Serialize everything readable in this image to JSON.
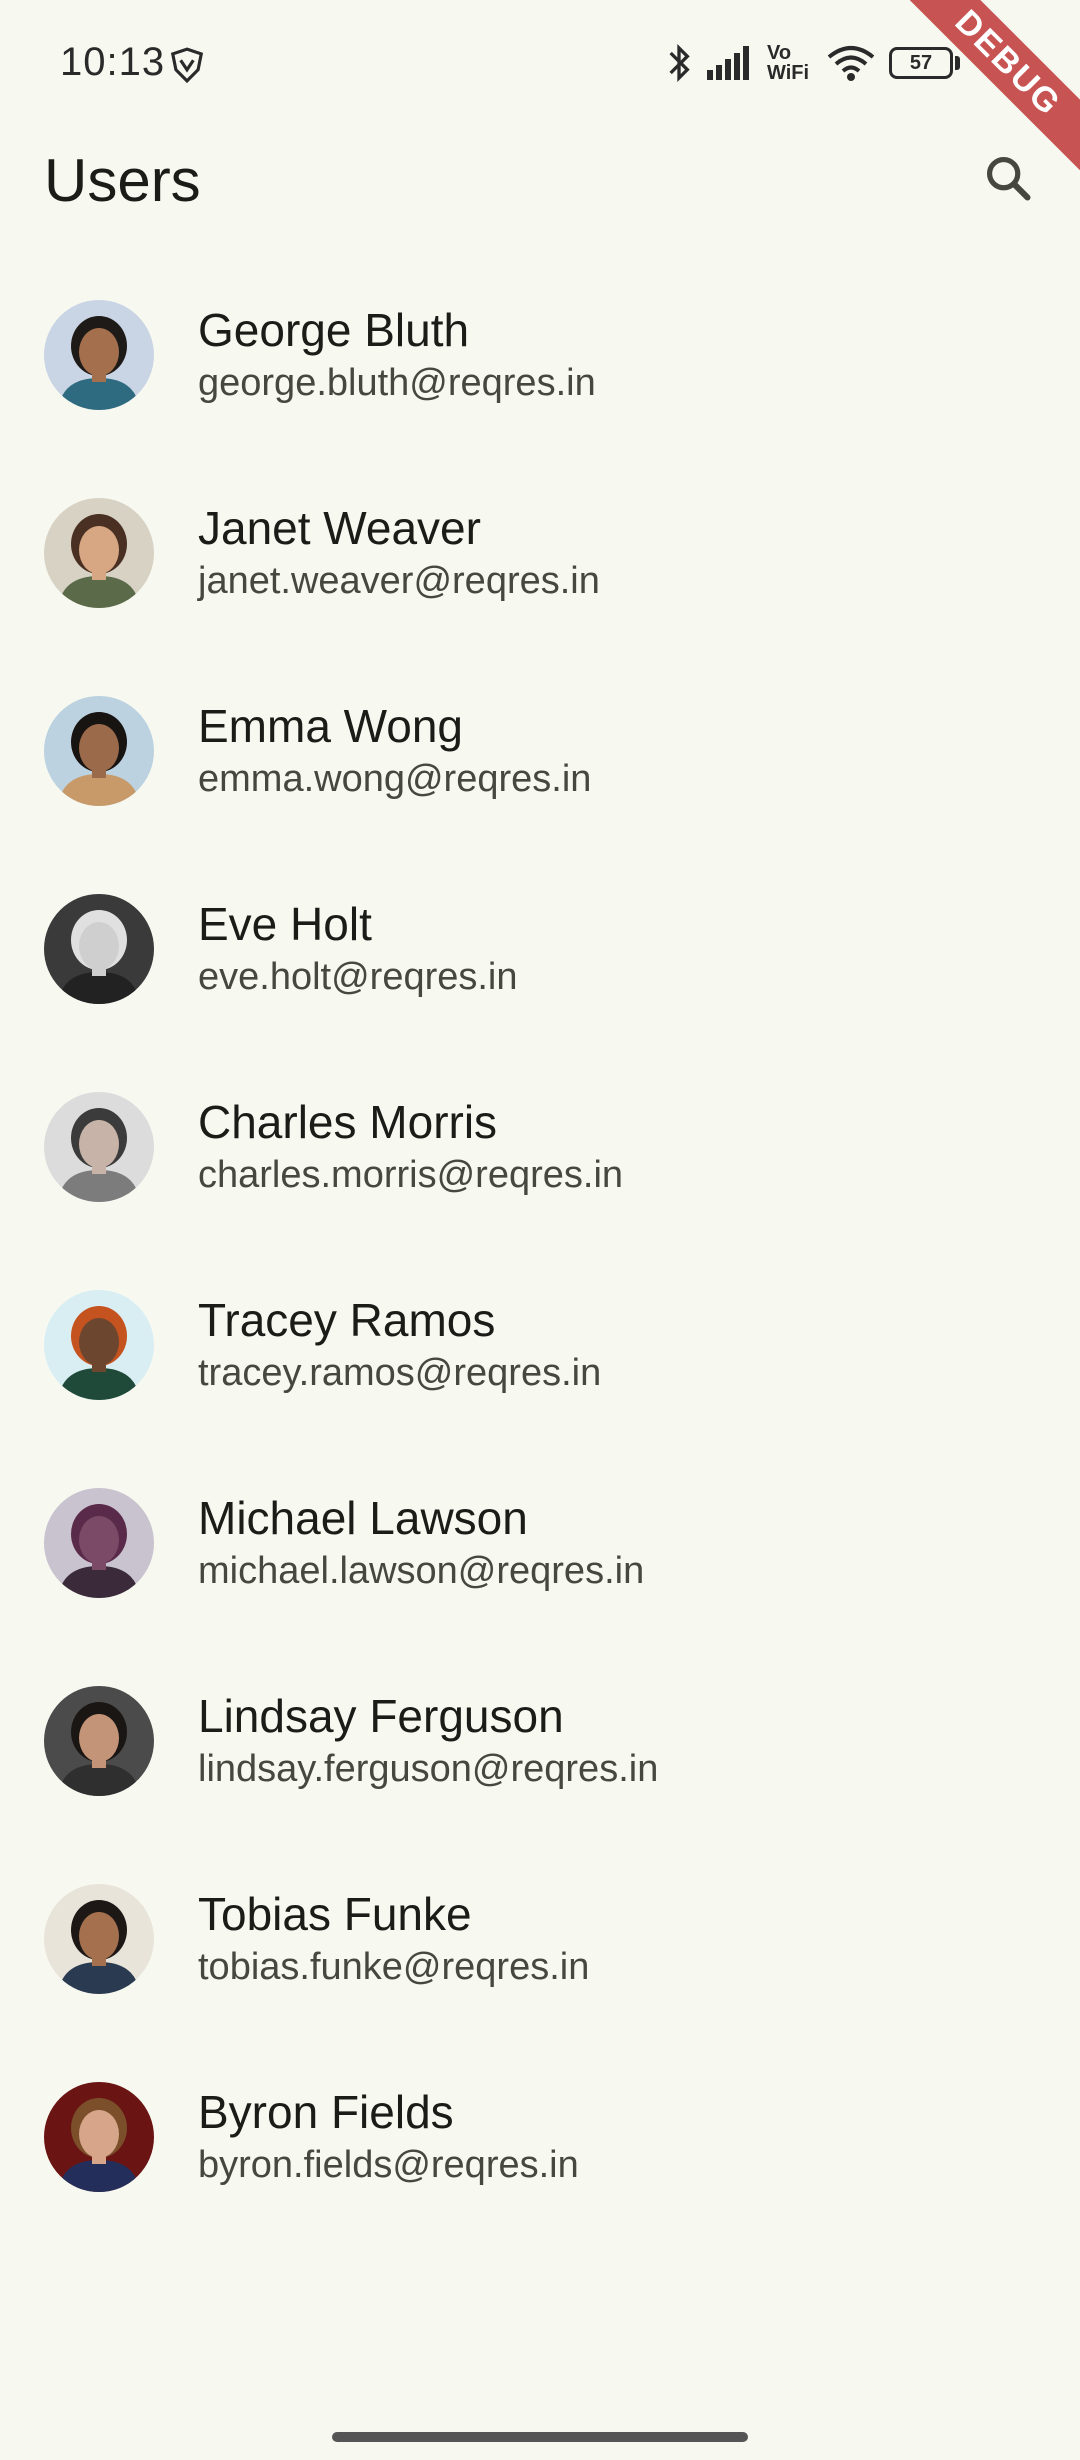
{
  "status_bar": {
    "time": "10:13",
    "volte_label": "Vo\nWiFi",
    "battery_level": "57"
  },
  "debug_banner": {
    "label": "DEBUG"
  },
  "app_bar": {
    "title": "Users",
    "search_icon": "search-icon"
  },
  "users": [
    {
      "name": "George Bluth",
      "email": "george.bluth@reqres.in",
      "avatar": {
        "bg": "#c9d4e4",
        "skin": "#a46f4d",
        "hair": "#1e1a17",
        "shirt": "#2f6b80"
      }
    },
    {
      "name": "Janet Weaver",
      "email": "janet.weaver@reqres.in",
      "avatar": {
        "bg": "#d8d2c4",
        "skin": "#d7a784",
        "hair": "#4a3022",
        "shirt": "#5b6b4a"
      }
    },
    {
      "name": "Emma Wong",
      "email": "emma.wong@reqres.in",
      "avatar": {
        "bg": "#bcd2e0",
        "skin": "#9b6a4b",
        "hair": "#171412",
        "shirt": "#c89a6a"
      }
    },
    {
      "name": "Eve Holt",
      "email": "eve.holt@reqres.in",
      "avatar": {
        "bg": "#3a3a3a",
        "skin": "#cfcfcf",
        "hair": "#e0e0e0",
        "shirt": "#222222"
      }
    },
    {
      "name": "Charles Morris",
      "email": "charles.morris@reqres.in",
      "avatar": {
        "bg": "#dcdcdc",
        "skin": "#c8b3a8",
        "hair": "#3b3b3b",
        "shirt": "#7c7c7c"
      }
    },
    {
      "name": "Tracey Ramos",
      "email": "tracey.ramos@reqres.in",
      "avatar": {
        "bg": "#d8eef3",
        "skin": "#6d4630",
        "hair": "#c5531f",
        "shirt": "#1f4a3a"
      }
    },
    {
      "name": "Michael Lawson",
      "email": "michael.lawson@reqres.in",
      "avatar": {
        "bg": "#c9c3cf",
        "skin": "#7a4a66",
        "hair": "#5a2a4a",
        "shirt": "#3a2a3a"
      }
    },
    {
      "name": "Lindsay Ferguson",
      "email": "lindsay.ferguson@reqres.in",
      "avatar": {
        "bg": "#4b4b4b",
        "skin": "#c39477",
        "hair": "#1a1614",
        "shirt": "#2f2f2f"
      }
    },
    {
      "name": "Tobias Funke",
      "email": "tobias.funke@reqres.in",
      "avatar": {
        "bg": "#e8e4da",
        "skin": "#a4704e",
        "hair": "#1d1815",
        "shirt": "#2a3a50"
      }
    },
    {
      "name": "Byron Fields",
      "email": "byron.fields@reqres.in",
      "avatar": {
        "bg": "#6a1414",
        "skin": "#d6a58a",
        "hair": "#7a4f2a",
        "shirt": "#232f5a"
      }
    }
  ],
  "colors": {
    "background": "#f7f9f1",
    "text_primary": "#1b1c18",
    "text_secondary": "#46483f",
    "debug_ribbon": "#b71c1c"
  }
}
